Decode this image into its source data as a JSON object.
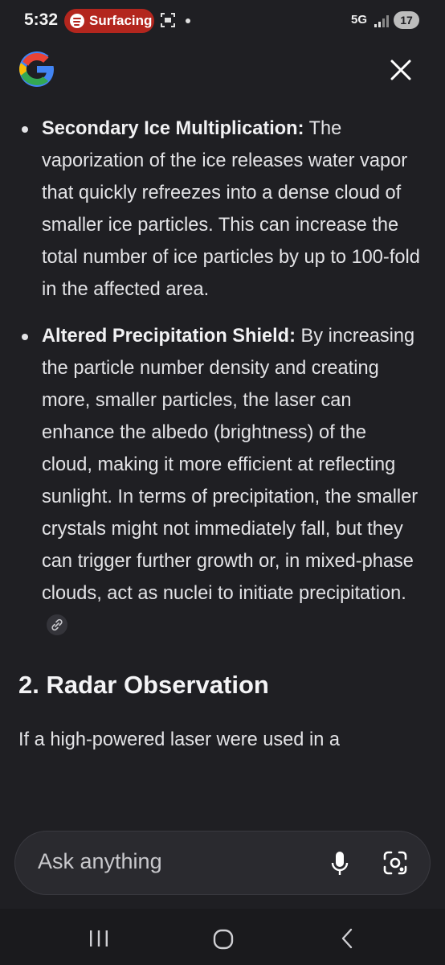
{
  "status_bar": {
    "time": "5:32",
    "media_label": "Surfacing",
    "network": "5G",
    "battery": "17"
  },
  "header": {
    "logo_icon": "google-g-icon",
    "close_icon": "close-icon"
  },
  "content": {
    "bullets": [
      {
        "term": "Secondary Ice Multiplication:",
        "text": " The vaporization of the ice releases water vapor that quickly refreezes into a dense cloud of smaller ice particles. This can increase the total number of ice particles by up to 100-fold in the affected area."
      },
      {
        "term": "Altered Precipitation Shield:",
        "text": " By increasing the particle number density and creating more, smaller particles, the laser can enhance the albedo (brightness) of the cloud, making it more efficient at reflecting sunlight. In terms of precipitation, the smaller crystals might not immediately fall, but they can trigger further growth or, in mixed-phase clouds, act as nuclei to initiate precipitation."
      }
    ],
    "section_heading": "2. Radar Observation",
    "paragraph": "If a high-powered laser were used in a"
  },
  "ask_bar": {
    "placeholder": "Ask anything"
  },
  "colors": {
    "background": "#1f1f23",
    "media_pill": "#b3261e",
    "text": "#e3e3e6"
  }
}
